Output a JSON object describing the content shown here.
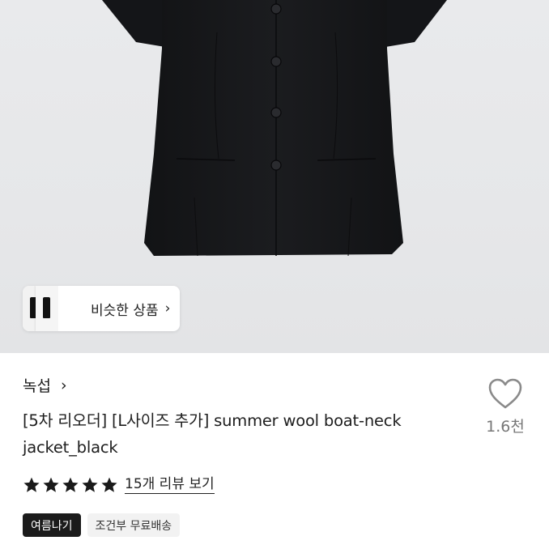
{
  "similar_products": {
    "label": "비슷한 상품",
    "chevron": "›"
  },
  "product": {
    "brand": "녹섭",
    "brand_chevron": "›",
    "title": "[5차 리오더] [L사이즈 추가] summer wool boat-neck jacket_black",
    "like_count": "1.6천",
    "rating": {
      "stars": 5,
      "max": 5,
      "star_color": "#1a1a1a"
    },
    "review_link": "15개 리뷰 보기",
    "tags": [
      {
        "label": "여름나기",
        "style": "dark"
      },
      {
        "label": "조건부 무료배송",
        "style": "light"
      }
    ]
  },
  "icons": {
    "like": "heart-outline-icon",
    "star": "star-icon",
    "chevron": "chevron-right-icon"
  }
}
